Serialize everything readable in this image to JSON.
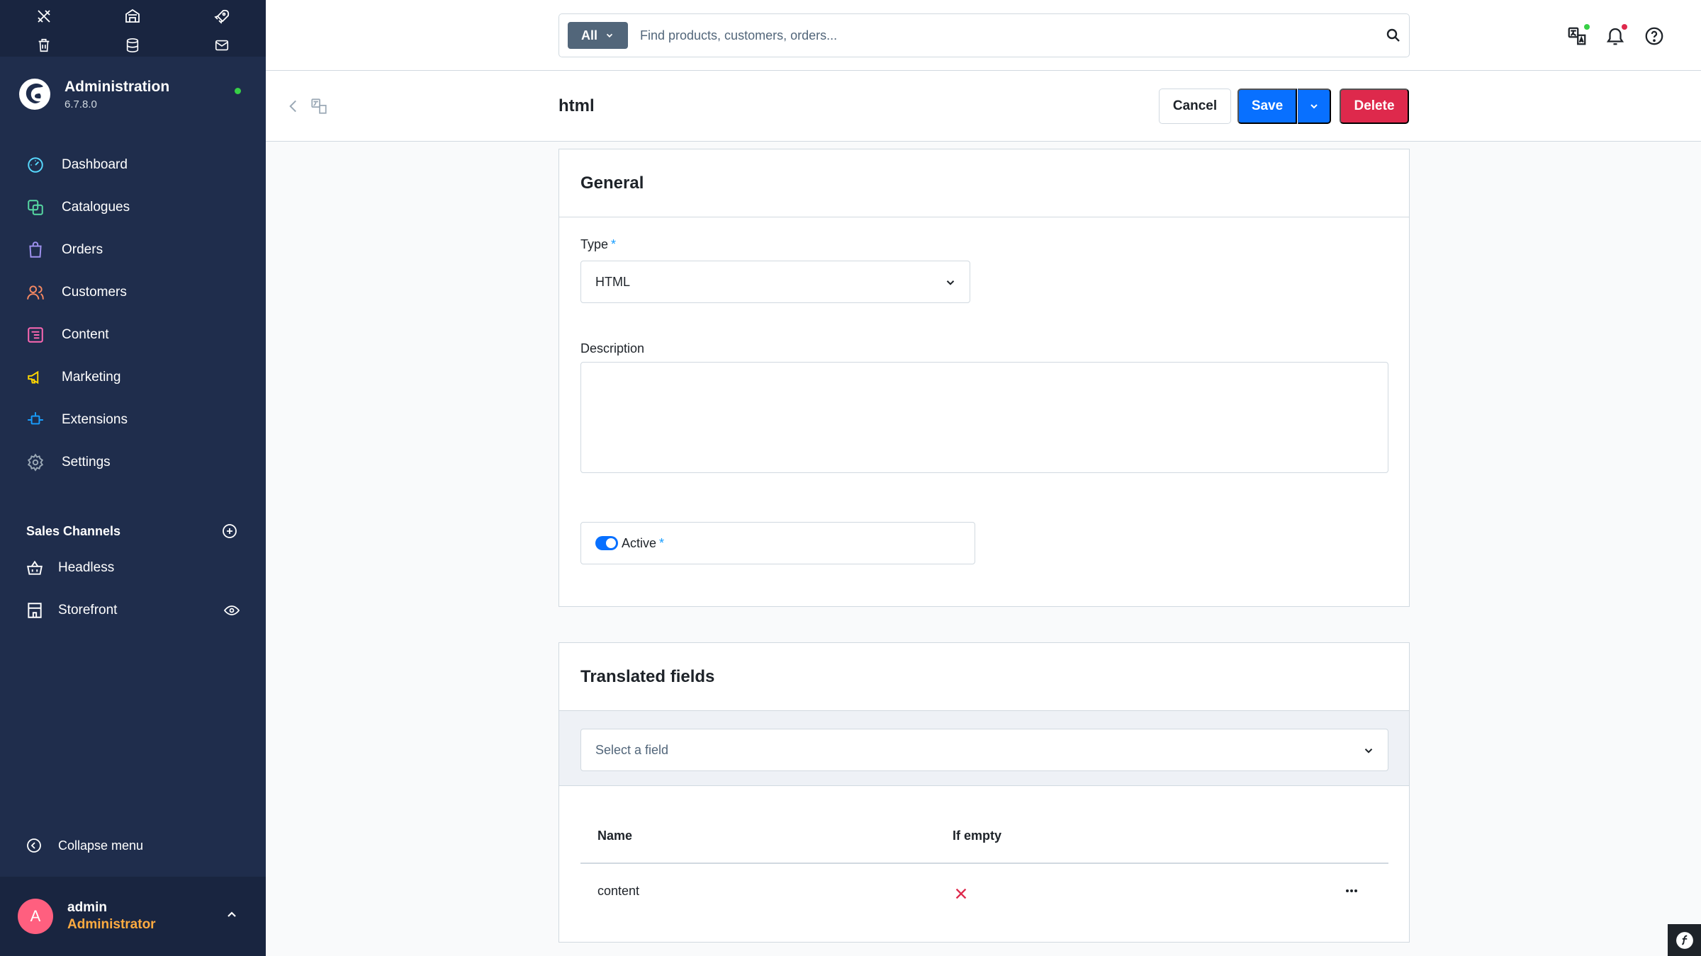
{
  "sidebar": {
    "brand": {
      "title": "Administration",
      "version": "6.7.8.0"
    },
    "nav": [
      {
        "label": "Dashboard",
        "icon": "dashboard-icon",
        "color": "#57d9ff"
      },
      {
        "label": "Catalogues",
        "icon": "catalogues-icon",
        "color": "#57d9a3"
      },
      {
        "label": "Orders",
        "icon": "orders-icon",
        "color": "#a092f0"
      },
      {
        "label": "Customers",
        "icon": "customers-icon",
        "color": "#f88962"
      },
      {
        "label": "Content",
        "icon": "content-icon",
        "color": "#ff68b4"
      },
      {
        "label": "Marketing",
        "icon": "marketing-icon",
        "color": "#ffd700"
      },
      {
        "label": "Extensions",
        "icon": "extensions-icon",
        "color": "#189eff"
      },
      {
        "label": "Settings",
        "icon": "settings-icon",
        "color": "#9aa8b5"
      }
    ],
    "sales_channels": {
      "title": "Sales Channels",
      "items": [
        {
          "label": "Headless"
        },
        {
          "label": "Storefront"
        }
      ]
    },
    "collapse_label": "Collapse menu",
    "user": {
      "initial": "A",
      "name": "admin",
      "role": "Administrator"
    }
  },
  "topbar": {
    "search_type": "All",
    "search_placeholder": "Find products, customers, orders..."
  },
  "smartbar": {
    "title": "html",
    "cancel_label": "Cancel",
    "save_label": "Save",
    "delete_label": "Delete"
  },
  "general": {
    "title": "General",
    "type_label": "Type",
    "type_value": "HTML",
    "required_mark": "*",
    "description_label": "Description",
    "description_value": "",
    "active_label": "Active",
    "active_value": true
  },
  "translated": {
    "title": "Translated fields",
    "select_placeholder": "Select a field",
    "columns": [
      "Name",
      "If empty"
    ],
    "rows": [
      {
        "name": "content",
        "if_empty": "cross"
      }
    ]
  },
  "colors": {
    "sidebar_bg": "#1f2d4c",
    "primary": "#0870ff",
    "danger": "#de294c",
    "required": "#189eff",
    "role": "#ffab40",
    "avatar": "#ff5f7f"
  }
}
